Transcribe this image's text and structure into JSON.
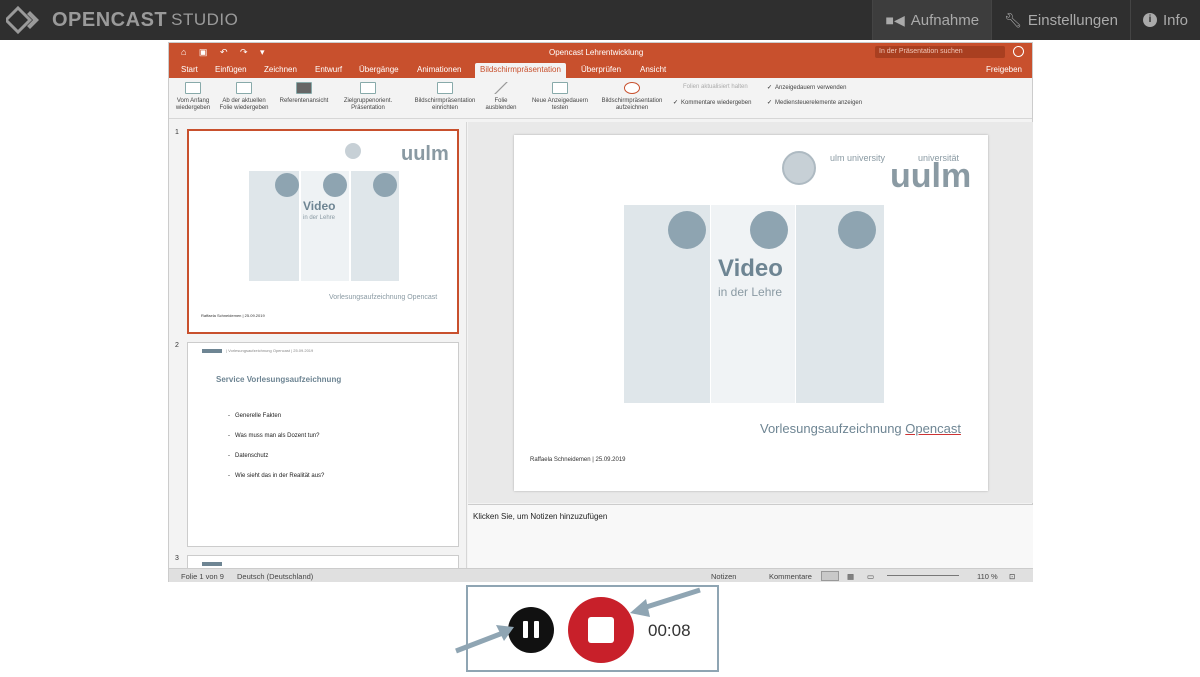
{
  "app": {
    "brand_name": "OPENCAST",
    "brand_sub": "STUDIO",
    "nav": [
      {
        "label": "Aufnahme",
        "icon": "video-camera-icon",
        "active": true
      },
      {
        "label": "Einstellungen",
        "icon": "wrench-icon",
        "active": false
      },
      {
        "label": "Info",
        "icon": "info-icon",
        "active": false
      }
    ]
  },
  "ppt": {
    "doc_title": "Opencast Lehrentwicklung",
    "search_placeholder": "In der Präsentation suchen",
    "tabs": [
      "Start",
      "Einfügen",
      "Zeichnen",
      "Entwurf",
      "Übergänge",
      "Animationen",
      "Bildschirmpräsentation",
      "Überprüfen",
      "Ansicht"
    ],
    "selected_tab": "Bildschirmpräsentation",
    "share": "Freigeben",
    "ribbon": {
      "from_start": [
        "Vom Anfang",
        "wiedergeben"
      ],
      "from_current": [
        "Ab der aktuellen",
        "Folie wiedergeben"
      ],
      "presenter": "Referentenansicht",
      "custom": [
        "Zielgruppenorient.",
        "Präsentation"
      ],
      "setup": [
        "Bildschirmpräsentation",
        "einrichten"
      ],
      "hide": [
        "Folie",
        "ausblenden"
      ],
      "rehearse": [
        "Neue Anzeigedauern",
        "testen"
      ],
      "record": [
        "Bildschirmpräsentation",
        "aufzeichnen"
      ],
      "keep_updated": "Folien aktualisiert halten",
      "play_comments": "Kommentare wiedergeben",
      "use_timings": "Anzeigedauern verwenden",
      "media_controls": "Mediensteuerelemente anzeigen"
    },
    "slide1": {
      "uni_small": "ulm university",
      "uni_small2": "universität",
      "uni_logo": "uulm",
      "video": "Video",
      "lehre": "in der Lehre",
      "subtitle_prefix": "Vorlesungsaufzeichnung ",
      "subtitle_link": "Opencast",
      "author": "Raffaela Schneidemen | 25.09.2019"
    },
    "slide2": {
      "header": "| Vorlesungsaufzeichnung Opencast | 25.09.2019",
      "title": "Service Vorlesungsaufzeichnung",
      "bullets": [
        "Generelle Fakten",
        "Was muss man als Dozent tun?",
        "Datenschutz",
        "Wie sieht das in der Realität aus?"
      ]
    },
    "slide_numbers": [
      "1",
      "2",
      "3"
    ],
    "notes_placeholder": "Klicken Sie, um Notizen hinzuzufügen",
    "status": {
      "slide_of": "Folie 1 von 9",
      "language": "Deutsch (Deutschland)",
      "notes": "Notizen",
      "comments": "Kommentare",
      "zoom": "110 %"
    }
  },
  "recorder": {
    "time": "00:08"
  }
}
